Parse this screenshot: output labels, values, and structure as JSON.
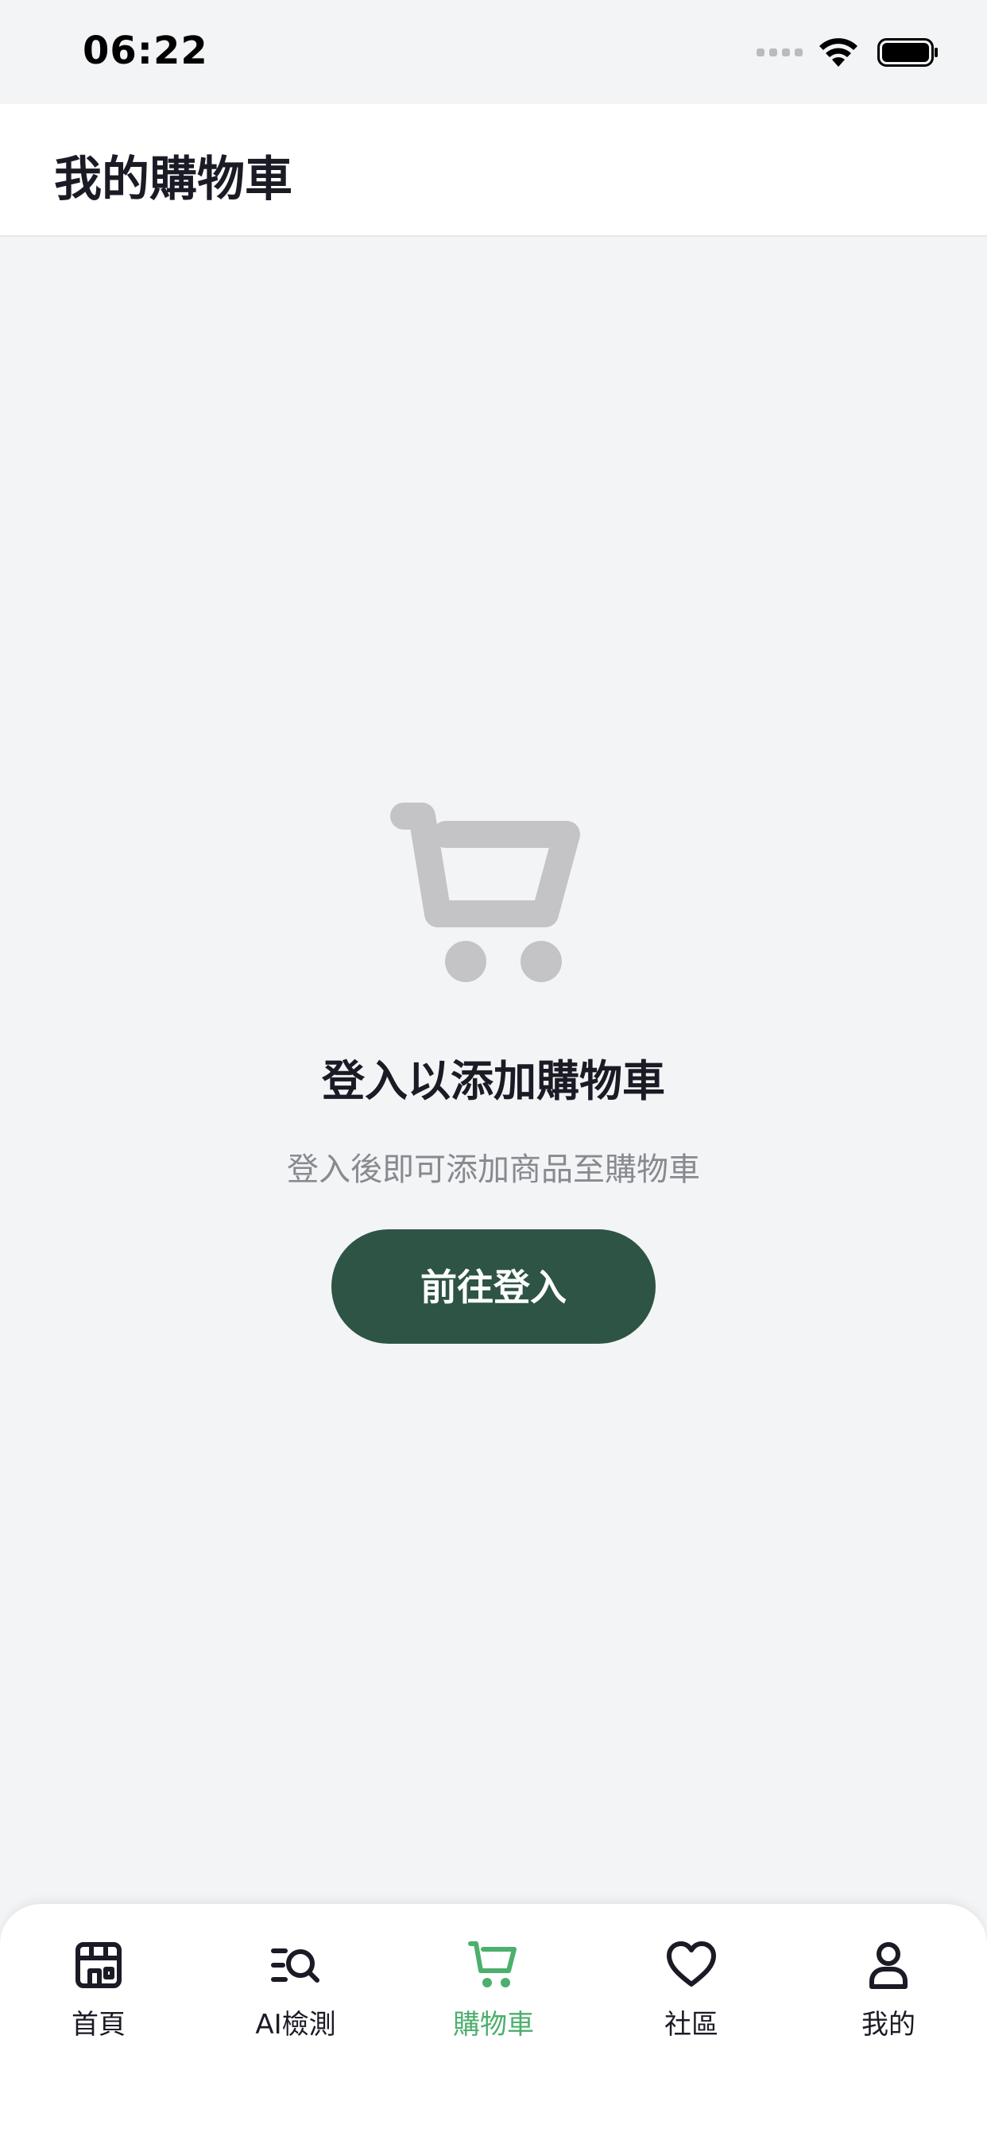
{
  "status_bar": {
    "time": "06:22"
  },
  "header": {
    "title": "我的購物車"
  },
  "empty_state": {
    "icon": "shopping-cart-icon",
    "title": "登入以添加購物車",
    "description": "登入後即可添加商品至購物車",
    "button_label": "前往登入"
  },
  "tab_bar": {
    "active_index": 2,
    "active_color": "#4caf6e",
    "items": [
      {
        "label": "首頁",
        "icon": "store-icon"
      },
      {
        "label": "AI檢測",
        "icon": "search-list-icon"
      },
      {
        "label": "購物車",
        "icon": "cart-icon"
      },
      {
        "label": "社區",
        "icon": "heart-icon"
      },
      {
        "label": "我的",
        "icon": "user-icon"
      }
    ]
  },
  "colors": {
    "background": "#f3f4f6",
    "primary_button": "#2d5444",
    "title_text": "#1b1b26",
    "secondary_text": "#888a90",
    "illustration": "#c4c4c6"
  }
}
